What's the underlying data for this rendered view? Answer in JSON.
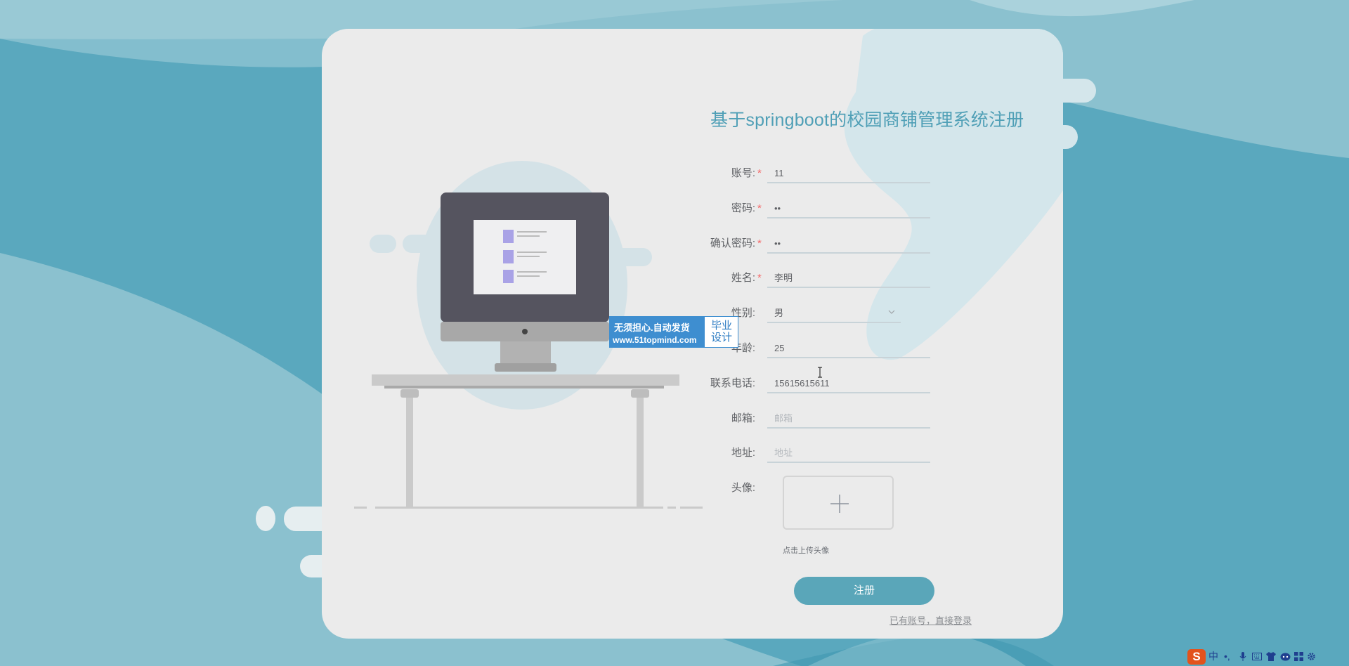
{
  "title": "基于springboot的校园商铺管理系统注册",
  "form": {
    "fields": [
      {
        "label": "账号:",
        "required": true,
        "value": "11",
        "placeholder": ""
      },
      {
        "label": "密码:",
        "required": true,
        "value": "••",
        "placeholder": ""
      },
      {
        "label": "确认密码:",
        "required": true,
        "value": "••",
        "placeholder": ""
      },
      {
        "label": "姓名:",
        "required": true,
        "value": "李明",
        "placeholder": ""
      },
      {
        "label": "性别:",
        "required": false,
        "value": "男",
        "placeholder": ""
      },
      {
        "label": "年龄:",
        "required": false,
        "value": "25",
        "placeholder": ""
      },
      {
        "label": "联系电话:",
        "required": false,
        "value": "15615615611",
        "placeholder": ""
      },
      {
        "label": "邮箱:",
        "required": false,
        "value": "",
        "placeholder": "邮箱"
      },
      {
        "label": "地址:",
        "required": false,
        "value": "",
        "placeholder": "地址"
      }
    ],
    "required_mark": "*",
    "avatar_label": "头像:",
    "avatar_tip": "点击上传头像",
    "submit_label": "注册",
    "login_link": "已有账号，直接登录"
  },
  "watermark": {
    "line1": "无须担心.自动发货",
    "line2": "www.51topmind.com",
    "badge_line1": "毕业",
    "badge_line2": "设计"
  },
  "taskbar": {
    "ime_logo": "S",
    "ime_mode": "中",
    "punct": "•,"
  },
  "colors": {
    "accent": "#5aa6b9",
    "title": "#4f9fb6",
    "required": "#f56c6c",
    "background": "#5aa9bf"
  }
}
